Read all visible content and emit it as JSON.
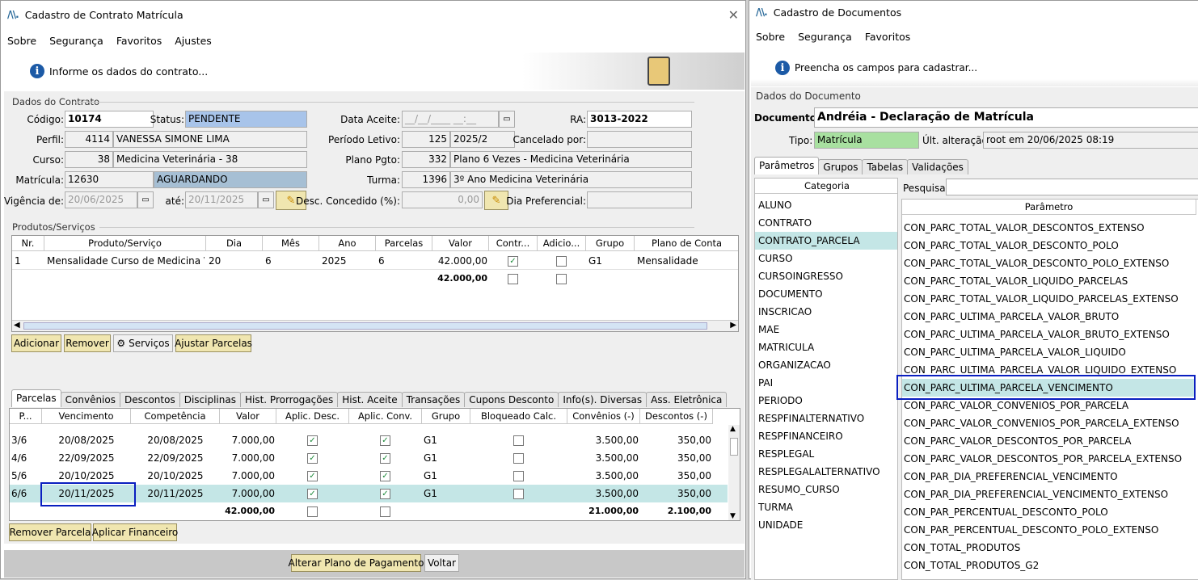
{
  "left_window": {
    "title": "Cadastro de Contrato Matrícula",
    "menu": [
      "Sobre",
      "Segurança",
      "Favoritos",
      "Ajustes"
    ],
    "info": "Informe os dados do contrato...",
    "section_contract": "Dados do Contrato",
    "labels": {
      "codigo": "Código:",
      "status": "Status:",
      "data_aceite": "Data Aceite:",
      "ra": "RA:",
      "perfil": "Perfil:",
      "periodo": "Período Letivo:",
      "cancelado": "Cancelado por:",
      "curso": "Curso:",
      "plano": "Plano Pgto:",
      "matricula": "Matrícula:",
      "turma": "Turma:",
      "vigencia": "Vigência de:",
      "ate": "até:",
      "desc": "Desc. Concedido (%):",
      "dia_pref": "Dia Preferencial:"
    },
    "values": {
      "codigo": "10174",
      "status": "PENDENTE",
      "data_aceite": "__/__/____ __:__",
      "ra": "3013-2022",
      "perfil_id": "4114",
      "perfil_nome": "VANESSA SIMONE LIMA",
      "periodo_id": "125",
      "periodo_nome": "2025/2",
      "cancelado": "",
      "curso_id": "38",
      "curso_nome": "Medicina Veterinária - 38",
      "plano_id": "332",
      "plano_nome": "Plano 6 Vezes - Medicina Veterinária",
      "matricula": "12630",
      "matricula_status": "AGUARDANDO",
      "turma_id": "1396",
      "turma_nome": "3º Ano Medicina Veterinária",
      "vig_de": "20/06/2025",
      "vig_ate": "20/11/2025",
      "desc": "0,00",
      "dia_pref": ""
    },
    "section_products": "Produtos/Serviços",
    "products_headers": [
      "Nr.",
      "Produto/Serviço",
      "Dia",
      "Mês",
      "Ano",
      "Parcelas",
      "Valor",
      "Contr...",
      "Adicio...",
      "Grupo",
      "Plano de Conta"
    ],
    "products_rows": [
      {
        "nr": "1",
        "produto": "Mensalidade Curso de Medicina Ve...",
        "dia": "20",
        "mes": "6",
        "ano": "2025",
        "parcelas": "6",
        "valor": "42.000,00",
        "contr": true,
        "adic": false,
        "grupo": "G1",
        "plano": "Mensalidade"
      }
    ],
    "products_total": "42.000,00",
    "product_buttons": {
      "adicionar": "Adicionar",
      "remover": "Remover",
      "servicos": "Serviços",
      "ajustar": "Ajustar Parcelas"
    },
    "tabs": [
      "Parcelas",
      "Convênios",
      "Descontos",
      "Disciplinas",
      "Hist. Prorrogações",
      "Hist. Aceite",
      "Transações",
      "Cupons Desconto",
      "Info(s). Diversas",
      "Ass. Eletrônica"
    ],
    "parcelas_headers": [
      "P...",
      "Vencimento",
      "Competência",
      "Valor",
      "Aplic. Desc.",
      "Aplic. Conv.",
      "Grupo",
      "Bloqueado Calc.",
      "Convênios (-)",
      "Descontos (-)"
    ],
    "parcelas_rows": [
      {
        "p": "3/6",
        "venc": "20/08/2025",
        "comp": "20/08/2025",
        "valor": "7.000,00",
        "desc": true,
        "conv": true,
        "grupo": "G1",
        "bloq": false,
        "convenios": "3.500,00",
        "descontos": "350,00"
      },
      {
        "p": "4/6",
        "venc": "22/09/2025",
        "comp": "22/09/2025",
        "valor": "7.000,00",
        "desc": true,
        "conv": true,
        "grupo": "G1",
        "bloq": false,
        "convenios": "3.500,00",
        "descontos": "350,00"
      },
      {
        "p": "5/6",
        "venc": "20/10/2025",
        "comp": "20/10/2025",
        "valor": "7.000,00",
        "desc": true,
        "conv": true,
        "grupo": "G1",
        "bloq": false,
        "convenios": "3.500,00",
        "descontos": "350,00"
      },
      {
        "p": "6/6",
        "venc": "20/11/2025",
        "comp": "20/11/2025",
        "valor": "7.000,00",
        "desc": true,
        "conv": true,
        "grupo": "G1",
        "bloq": false,
        "convenios": "3.500,00",
        "descontos": "350,00"
      }
    ],
    "parcelas_totals": {
      "valor": "42.000,00",
      "convenios": "21.000,00",
      "descontos": "2.100,00"
    },
    "parcela_buttons": {
      "remover": "Remover Parcela",
      "aplicar": "Aplicar Financeiro"
    },
    "footer_buttons": {
      "alterar": "Alterar Plano de Pagamento",
      "voltar": "Voltar"
    }
  },
  "right_window": {
    "title": "Cadastro de Documentos",
    "menu": [
      "Sobre",
      "Segurança",
      "Favoritos"
    ],
    "info": "Preencha os campos para cadastrar...",
    "section": "Dados do Documento",
    "labels": {
      "documento": "Documento:",
      "tipo": "Tipo:",
      "ult": "Últ. alteração:",
      "pesquisar": "Pesquisar:"
    },
    "values": {
      "documento": "Andréia - Declaração de Matrícula",
      "tipo": "Matrícula",
      "ult": "root em 20/06/2025 08:19"
    },
    "tabs": [
      "Parâmetros",
      "Grupos",
      "Tabelas",
      "Validações"
    ],
    "categoria_header": "Categoria",
    "categorias": [
      "ALUNO",
      "CONTRATO",
      "CONTRATO_PARCELA",
      "CURSO",
      "CURSOINGRESSO",
      "DOCUMENTO",
      "INSCRICAO",
      "MAE",
      "MATRICULA",
      "ORGANIZACAO",
      "PAI",
      "PERIODO",
      "RESPFINALTERNATIVO",
      "RESPFINANCEIRO",
      "RESPLEGAL",
      "RESPLEGALALTERNATIVO",
      "RESUMO_CURSO",
      "TURMA",
      "UNIDADE"
    ],
    "parametro_header": "Parâmetro",
    "parametros": [
      "CON_PARC_TOTAL_VALOR_DESCONTOS_EXTENSO",
      "CON_PARC_TOTAL_VALOR_DESCONTO_POLO",
      "CON_PARC_TOTAL_VALOR_DESCONTO_POLO_EXTENSO",
      "CON_PARC_TOTAL_VALOR_LIQUIDO_PARCELAS",
      "CON_PARC_TOTAL_VALOR_LIQUIDO_PARCELAS_EXTENSO",
      "CON_PARC_ULTIMA_PARCELA_VALOR_BRUTO",
      "CON_PARC_ULTIMA_PARCELA_VALOR_BRUTO_EXTENSO",
      "CON_PARC_ULTIMA_PARCELA_VALOR_LIQUIDO",
      "CON_PARC_ULTIMA_PARCELA_VALOR_LIQUIDO_EXTENSO",
      "CON_PARC_ULTIMA_PARCELA_VENCIMENTO",
      "CON_PARC_VALOR_CONVENIOS_POR_PARCELA",
      "CON_PARC_VALOR_CONVENIOS_POR_PARCELA_EXTENSO",
      "CON_PARC_VALOR_DESCONTOS_POR_PARCELA",
      "CON_PARC_VALOR_DESCONTOS_POR_PARCELA_EXTENSO",
      "CON_PAR_DIA_PREFERENCIAL_VENCIMENTO",
      "CON_PAR_DIA_PREFERENCIAL_VENCIMENTO_EXTENSO",
      "CON_PAR_PERCENTUAL_DESCONTO_POLO",
      "CON_PAR_PERCENTUAL_DESCONTO_POLO_EXTENSO",
      "CON_TOTAL_PRODUTOS",
      "CON_TOTAL_PRODUTOS_G2"
    ]
  },
  "colors": {
    "status_blue": "#a8c4ea",
    "aguardando": "#a6bfd4",
    "tipo_green": "#a8e0a0",
    "selected_row": "#c4e6e6",
    "highlight_box": "#0a1fc0",
    "button_yellow": "#f0e6b0"
  }
}
